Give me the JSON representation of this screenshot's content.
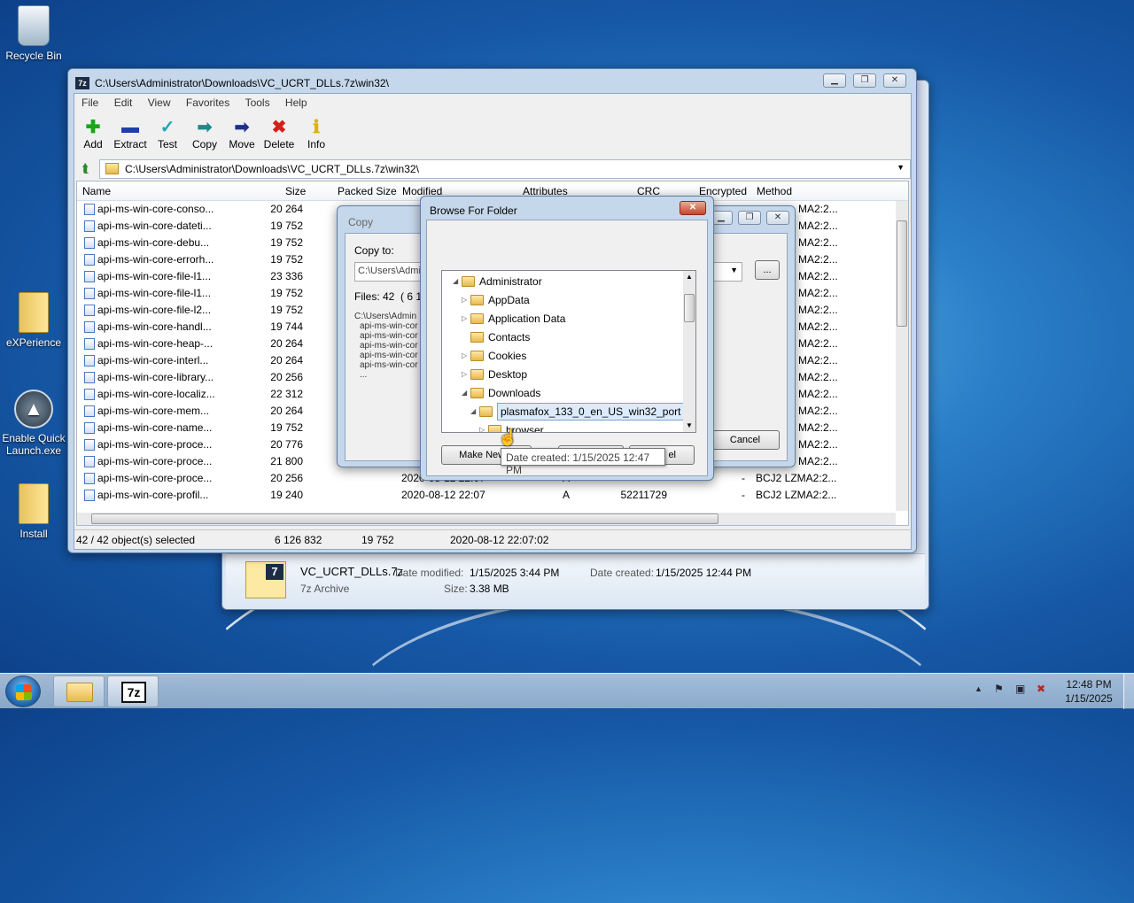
{
  "desktop": {
    "icons": [
      {
        "label": "Recycle Bin"
      },
      {
        "label": "eXPerience"
      },
      {
        "label": "Enable Quick Launch.exe"
      },
      {
        "label": "Install"
      }
    ]
  },
  "main_window": {
    "title": "C:\\Users\\Administrator\\Downloads\\VC_UCRT_DLLs.7z\\win32\\",
    "app_icon": "7z",
    "menu": [
      "File",
      "Edit",
      "View",
      "Favorites",
      "Tools",
      "Help"
    ],
    "toolbar": [
      {
        "label": "Add",
        "icon": "plus-icon",
        "color": "#1aa51a"
      },
      {
        "label": "Extract",
        "icon": "minus-icon",
        "color": "#1f3fa8"
      },
      {
        "label": "Test",
        "icon": "check-chevron-icon",
        "color": "#22a7b0"
      },
      {
        "label": "Copy",
        "icon": "copy-arrow-icon",
        "color": "#1b8a8a"
      },
      {
        "label": "Move",
        "icon": "move-arrow-icon",
        "color": "#1c2f8a"
      },
      {
        "label": "Delete",
        "icon": "delete-x-icon",
        "color": "#d4201a"
      },
      {
        "label": "Info",
        "icon": "info-icon",
        "color": "#d8b400"
      }
    ],
    "address": "C:\\Users\\Administrator\\Downloads\\VC_UCRT_DLLs.7z\\win32\\",
    "columns": [
      "Name",
      "Size",
      "Packed Size",
      "Modified",
      "Attributes",
      "CRC",
      "Encrypted",
      "Method"
    ],
    "rows": [
      {
        "name": "api-ms-win-core-conso...",
        "size": "20 264",
        "method": "MA2:2..."
      },
      {
        "name": "api-ms-win-core-dateti...",
        "size": "19 752",
        "method": "MA2:2..."
      },
      {
        "name": "api-ms-win-core-debu...",
        "size": "19 752",
        "method": "MA2:2..."
      },
      {
        "name": "api-ms-win-core-errorh...",
        "size": "19 752",
        "method": "MA2:2..."
      },
      {
        "name": "api-ms-win-core-file-l1...",
        "size": "23 336",
        "method": "MA2:2..."
      },
      {
        "name": "api-ms-win-core-file-l1...",
        "size": "19 752",
        "method": "MA2:2..."
      },
      {
        "name": "api-ms-win-core-file-l2...",
        "size": "19 752",
        "method": "MA2:2..."
      },
      {
        "name": "api-ms-win-core-handl...",
        "size": "19 744",
        "method": "MA2:2..."
      },
      {
        "name": "api-ms-win-core-heap-...",
        "size": "20 264",
        "method": "MA2:2..."
      },
      {
        "name": "api-ms-win-core-interl...",
        "size": "20 264",
        "method": "MA2:2..."
      },
      {
        "name": "api-ms-win-core-library...",
        "size": "20 256",
        "method": "MA2:2..."
      },
      {
        "name": "api-ms-win-core-localiz...",
        "size": "22 312",
        "method": "MA2:2..."
      },
      {
        "name": "api-ms-win-core-mem...",
        "size": "20 264",
        "method": "MA2:2..."
      },
      {
        "name": "api-ms-win-core-name...",
        "size": "19 752",
        "method": "MA2:2..."
      },
      {
        "name": "api-ms-win-core-proce...",
        "size": "20 776",
        "method": "MA2:2..."
      },
      {
        "name": "api-ms-win-core-proce...",
        "size": "21 800",
        "method": "MA2:2..."
      },
      {
        "name": "api-ms-win-core-proce...",
        "size": "20 256",
        "modified": "2020-08-12 22:07",
        "attr": "A",
        "crc": "",
        "enc": "-",
        "method": "BCJ2 LZMA2:2..."
      },
      {
        "name": "api-ms-win-core-profil...",
        "size": "19 240",
        "modified": "2020-08-12 22:07",
        "attr": "A",
        "crc": "52211729",
        "enc": "-",
        "method": "BCJ2 LZMA2:2..."
      }
    ],
    "status": {
      "selected": "42 / 42 object(s) selected",
      "total": "6 126 832",
      "size": "19 752",
      "date": "2020-08-12 22:07:02"
    }
  },
  "copy_dialog": {
    "title": "Copy",
    "copy_to_label": "Copy to:",
    "path_value": "C:\\Users\\Admi",
    "browse_label": "...",
    "files_label": "Files: 42",
    "files_extra": "( 6 1",
    "list_header": "C:\\Users\\Admin",
    "list_items": [
      "api-ms-win-cor",
      "api-ms-win-cor",
      "api-ms-win-cor",
      "api-ms-win-cor",
      "api-ms-win-cor",
      "..."
    ],
    "cancel_label": "Cancel"
  },
  "browse_dialog": {
    "title": "Browse For Folder",
    "tree": [
      {
        "label": "Administrator",
        "expanded": true,
        "level": 0
      },
      {
        "label": "AppData",
        "expanded": false,
        "level": 1
      },
      {
        "label": "Application Data",
        "expanded": false,
        "level": 1
      },
      {
        "label": "Contacts",
        "expanded": null,
        "level": 1
      },
      {
        "label": "Cookies",
        "expanded": false,
        "level": 1
      },
      {
        "label": "Desktop",
        "expanded": false,
        "level": 1
      },
      {
        "label": "Downloads",
        "expanded": true,
        "level": 1
      },
      {
        "label": "plasmafox_133_0_en_US_win32_port",
        "expanded": true,
        "level": 2,
        "selected": true
      },
      {
        "label": "browser",
        "expanded": false,
        "level": 3
      }
    ],
    "make_new_label": "Make New F",
    "ok_label": "",
    "cancel_label": "el",
    "tooltip": "Date created: 1/15/2025 12:47 PM"
  },
  "explorer_details": {
    "file_name": "VC_UCRT_DLLs.7z",
    "file_type": "7z Archive",
    "modified_label": "Date modified:",
    "modified_value": "1/15/2025 3:44 PM",
    "size_label": "Size:",
    "size_value": "3.38 MB",
    "created_label": "Date created:",
    "created_value": "1/15/2025 12:44 PM"
  },
  "taskbar": {
    "clock_time": "12:48 PM",
    "clock_date": "1/15/2025",
    "app_7z_label": "7z"
  }
}
